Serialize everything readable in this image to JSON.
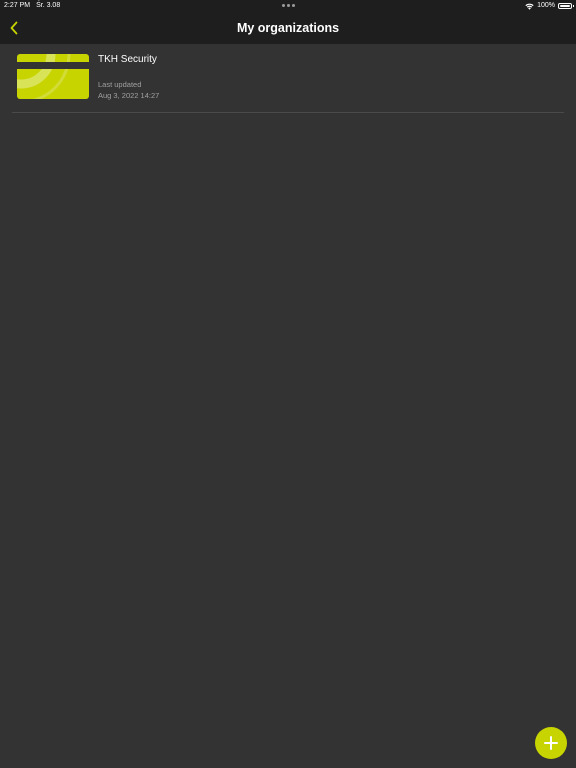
{
  "status_bar": {
    "time": "2:27 PM",
    "date": "Śr. 3.08",
    "battery": "100%"
  },
  "nav": {
    "title": "My organizations",
    "back_icon": "chevron-left-icon"
  },
  "organizations": [
    {
      "name": "TKH Security",
      "updated_label": "Last updated",
      "updated_value": "Aug 3, 2022 14:27"
    }
  ],
  "fab": {
    "icon": "plus-icon"
  },
  "colors": {
    "accent": "#c8d400",
    "background": "#333333",
    "bar": "#1e1e1e",
    "secondary_text": "#a0a0a0"
  }
}
